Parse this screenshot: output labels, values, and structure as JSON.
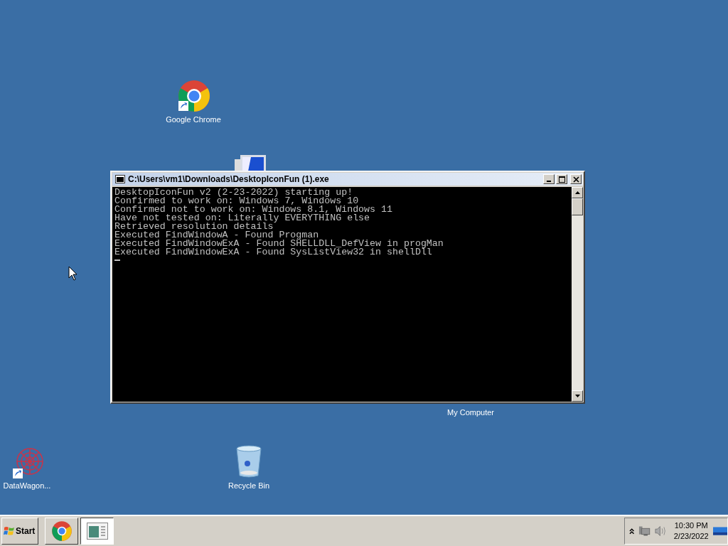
{
  "desktop_icons": [
    {
      "kind": "chrome",
      "label": "Google Chrome"
    },
    {
      "kind": "computer",
      "label": "My Computer"
    },
    {
      "kind": "datawagon",
      "label": "DataWagon..."
    },
    {
      "kind": "recycle",
      "label": "Recycle Bin"
    }
  ],
  "console_window": {
    "title": "C:\\Users\\vm1\\Downloads\\DesktopIconFun (1).exe",
    "lines": [
      "DesktopIconFun v2 (2-23-2022) starting up!",
      "Confirmed to work on: Windows 7, Windows 10",
      "Confirmed not to work on: Windows 8.1, Windows 11",
      "Have not tested on: Literally EVERYTHING else",
      "Retrieved resolution details",
      "Executed FindWindowA - Found Progman",
      "Executed FindWindowExA - Found SHELLDLL_DefView in progMan",
      "Executed FindWindowExA - Found SysListView32 in shellDll"
    ]
  },
  "taskbar": {
    "start": "Start",
    "apps": [
      {
        "kind": "chrome",
        "selected": false
      },
      {
        "kind": "console",
        "selected": true
      }
    ],
    "clock": {
      "time": "10:30 PM",
      "date": "2/23/2022"
    }
  }
}
